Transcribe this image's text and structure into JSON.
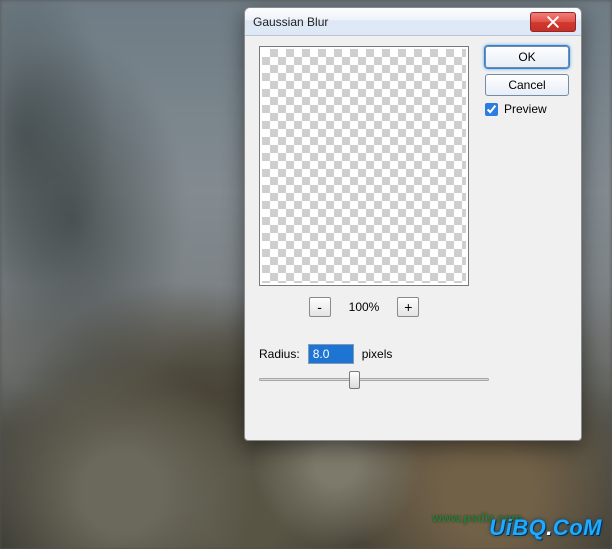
{
  "dialog": {
    "title": "Gaussian Blur",
    "ok_label": "OK",
    "cancel_label": "Cancel",
    "preview_label": "Preview",
    "preview_checked": true,
    "zoom": {
      "minus": "-",
      "value": "100%",
      "plus": "+"
    },
    "radius": {
      "label": "Radius:",
      "value": "8.0",
      "unit": "pixels"
    },
    "slider_percent": 41
  },
  "watermark": {
    "brand_pre": "UiBQ",
    "brand_dot": ".",
    "brand_post": "CoM",
    "faint": "www.psdiz.com"
  }
}
